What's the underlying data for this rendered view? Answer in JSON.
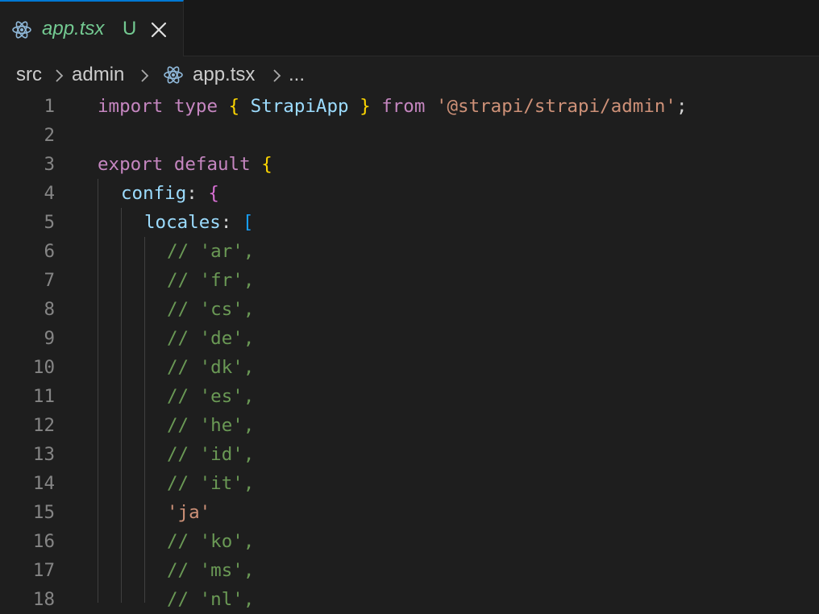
{
  "tab": {
    "filename": "app.tsx",
    "badge": "U",
    "close": "✕"
  },
  "breadcrumb": {
    "items": [
      "src",
      "admin",
      "app.tsx",
      "..."
    ]
  },
  "editor": {
    "lines": [
      {
        "num": "1"
      },
      {
        "num": "2"
      },
      {
        "num": "3"
      },
      {
        "num": "4"
      },
      {
        "num": "5"
      },
      {
        "num": "6"
      },
      {
        "num": "7"
      },
      {
        "num": "8"
      },
      {
        "num": "9"
      },
      {
        "num": "10"
      },
      {
        "num": "11"
      },
      {
        "num": "12"
      },
      {
        "num": "13"
      },
      {
        "num": "14"
      },
      {
        "num": "15"
      },
      {
        "num": "16"
      },
      {
        "num": "17"
      },
      {
        "num": "18"
      }
    ],
    "tokens": {
      "l1": [
        "import",
        " ",
        "type",
        " ",
        "{",
        " ",
        "StrapiApp",
        " ",
        "}",
        " ",
        "from",
        " ",
        "'@strapi/strapi/admin'",
        ";"
      ],
      "l3": [
        "export",
        " ",
        "default",
        " ",
        "{"
      ],
      "l4": [
        "config",
        ": ",
        "{"
      ],
      "l5": [
        "locales",
        ": ",
        "["
      ],
      "comments": [
        "// 'ar',",
        "// 'fr',",
        "// 'cs',",
        "// 'de',",
        "// 'dk',",
        "// 'es',",
        "// 'he',",
        "// 'id',",
        "// 'it',"
      ],
      "l15": "'ja'",
      "comments2": [
        "// 'ko',",
        "// 'ms',",
        "// 'nl',"
      ]
    }
  },
  "colors": {
    "tab_accent": "#0078d4",
    "untracked": "#73c991",
    "background": "#1e1e1e"
  }
}
